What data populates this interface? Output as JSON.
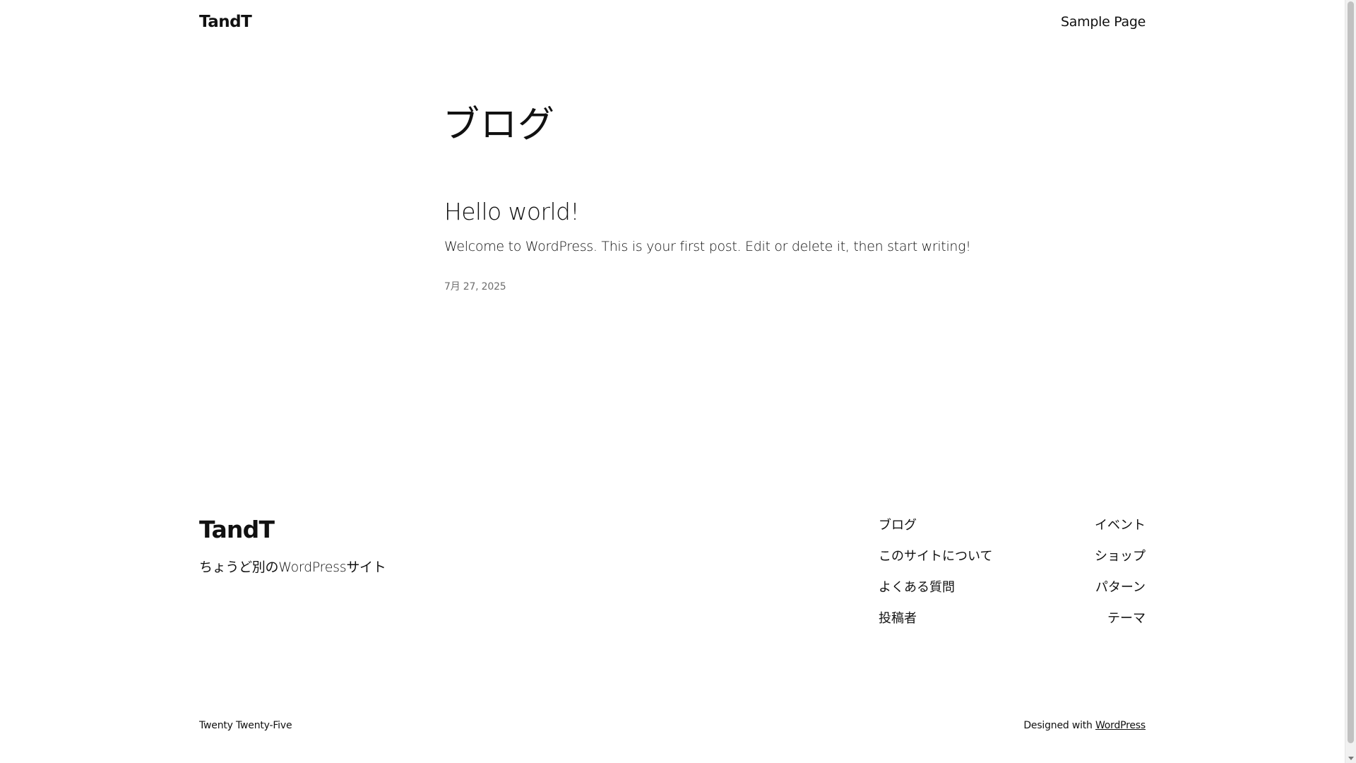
{
  "header": {
    "site_title": "TandT",
    "nav_item": "Sample Page"
  },
  "main": {
    "page_heading": "ブログ",
    "posts": [
      {
        "title": "Hello world!",
        "excerpt": "Welcome to WordPress. This is your first post. Edit or delete it, then start writing!",
        "date": "7月 27, 2025"
      }
    ]
  },
  "footer": {
    "site_title": "TandT",
    "tagline": "ちょうど別のWordPressサイト",
    "nav_left": [
      "ブログ",
      "このサイトについて",
      "よくある質問",
      "投稿者"
    ],
    "nav_right": [
      "イベント",
      "ショップ",
      "パターン",
      "テーマ"
    ],
    "credit_left": "Twenty Twenty-Five",
    "credit_right_prefix": "Designed with ",
    "credit_right_link": "WordPress"
  }
}
